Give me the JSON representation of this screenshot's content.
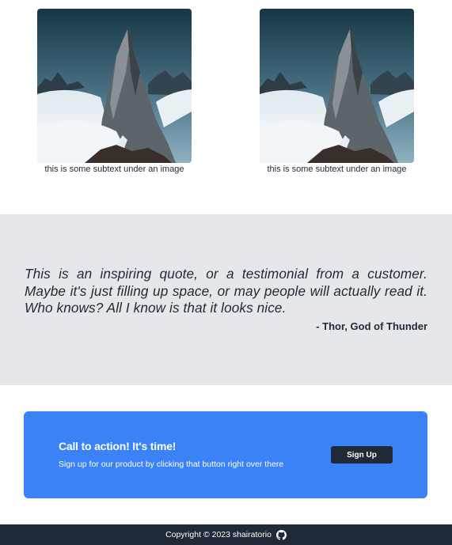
{
  "gallery": {
    "items": [
      {
        "caption": "this is some subtext under an image",
        "image": "mountain-peak-photo"
      },
      {
        "caption": "this is some subtext under an image",
        "image": "mountain-peak-photo"
      }
    ]
  },
  "testimonial": {
    "quote": "This is an inspiring quote, or a testimonial from a customer. Maybe it's just filling up space, or may people will actually read it. Who knows? All I know is that it looks nice.",
    "author": "- Thor, God of Thunder"
  },
  "cta": {
    "title": "Call to action! It's time!",
    "subtitle": "Sign up for our product by clicking that button right over there",
    "button_label": "Sign Up"
  },
  "footer": {
    "copyright": "Copyright © 2023 shairatorio",
    "icon": "github-icon"
  },
  "colors": {
    "quote_band": "#e5e7eb",
    "cta_bg": "#3b82f6",
    "dark": "#1f2937"
  }
}
